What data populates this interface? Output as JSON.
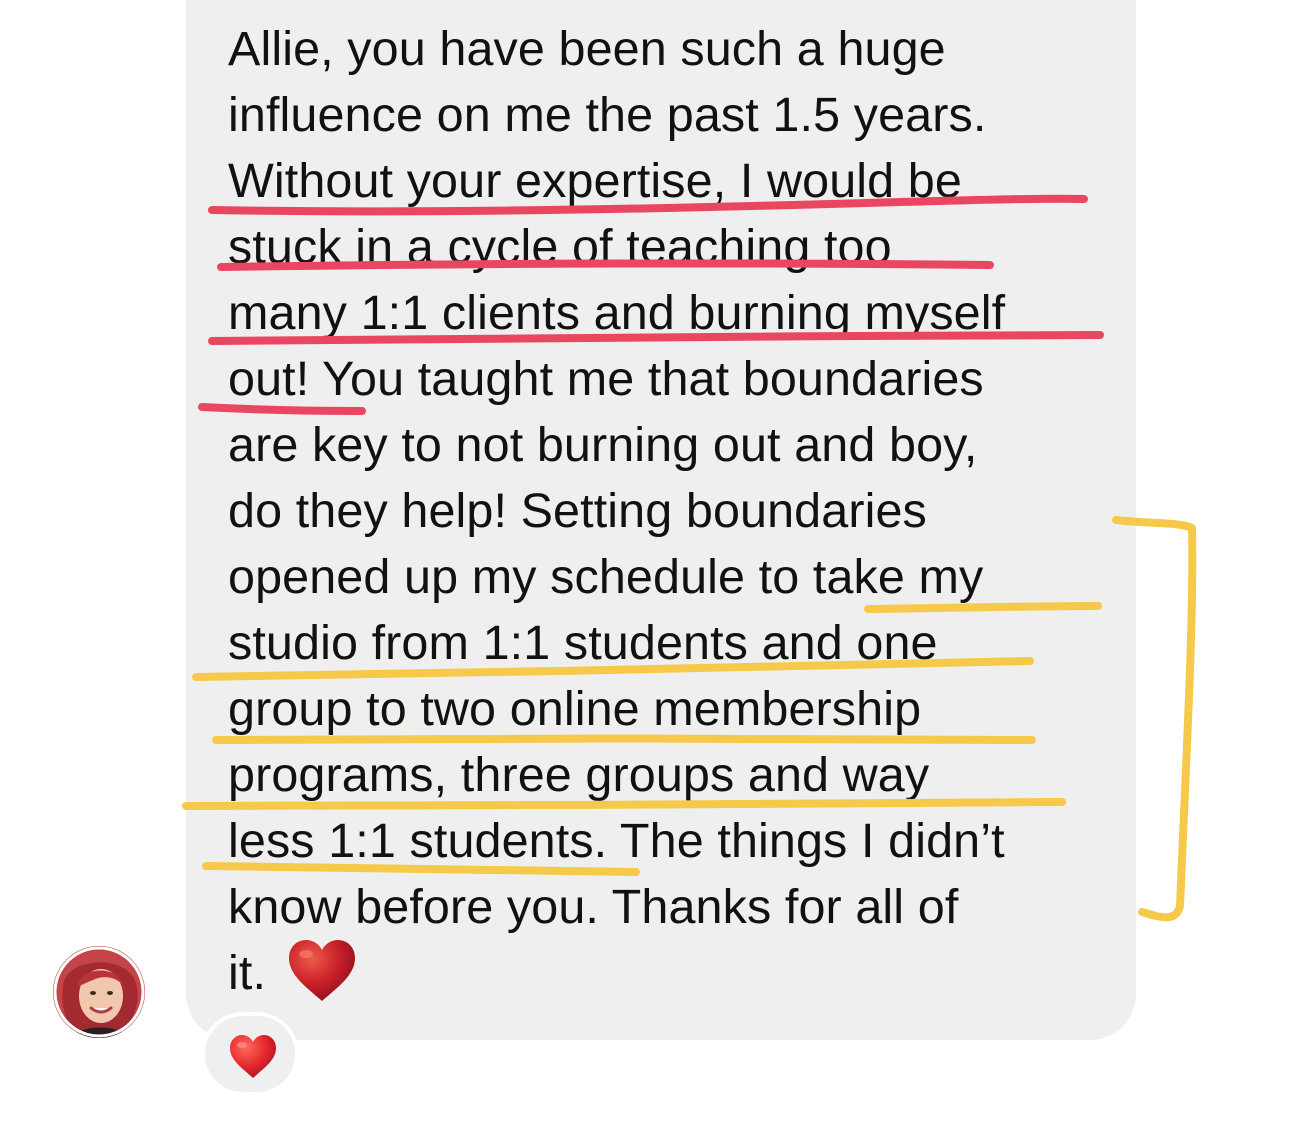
{
  "message": {
    "lines": [
      "Allie, you have been such a huge",
      "influence on me the past 1.5 years.",
      "Without your expertise, I would be",
      "stuck in a cycle of teaching too",
      "many 1:1 clients and burning myself",
      "out! You taught me that boundaries",
      "are key to not burning out and boy,",
      "do they help! Setting boundaries",
      "opened up my schedule to take my",
      "studio from 1:1 students and one",
      "group to two online membership",
      "programs, three groups and way",
      "less 1:1 students. The things I didn’t",
      "know before you. Thanks for all of",
      "it."
    ],
    "trailing_emoji": "heart-emoji"
  },
  "reaction": {
    "emoji": "heart-emoji"
  },
  "avatar": {
    "icon": "profile-photo"
  },
  "annotations": {
    "underline_color_red": "#e8475f",
    "underline_color_yellow": "#f6c94a"
  },
  "colors": {
    "bubble": "#efefef",
    "text": "#111111",
    "heart": "#d42a2a"
  }
}
